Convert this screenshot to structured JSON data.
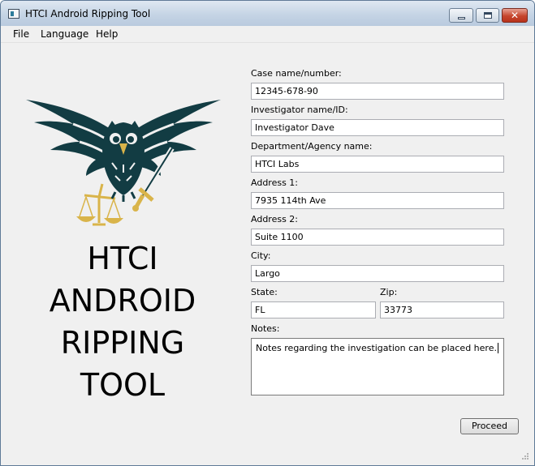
{
  "window": {
    "title": "HTCI Android Ripping Tool"
  },
  "menu": {
    "items": [
      "File",
      "Language",
      "Help"
    ]
  },
  "banner": {
    "lines": [
      "HTCI",
      "ANDROID",
      "RIPPING",
      "TOOL"
    ]
  },
  "form": {
    "case_label": "Case name/number:",
    "case_value": "12345-678-90",
    "investigator_label": "Investigator name/ID:",
    "investigator_value": "Investigator Dave",
    "department_label": "Department/Agency name:",
    "department_value": "HTCI Labs",
    "address1_label": "Address 1:",
    "address1_value": "7935 114th Ave",
    "address2_label": "Address 2:",
    "address2_value": "Suite 1100",
    "city_label": "City:",
    "city_value": "Largo",
    "state_label": "State:",
    "state_value": "FL",
    "zip_label": "Zip:",
    "zip_value": "33773",
    "notes_label": "Notes:",
    "notes_value": "Notes regarding the investigation can be placed here."
  },
  "actions": {
    "proceed_label": "Proceed"
  },
  "colors": {
    "logo_dark": "#123c43",
    "logo_gold": "#d9b44a",
    "close_red": "#c6452d"
  }
}
